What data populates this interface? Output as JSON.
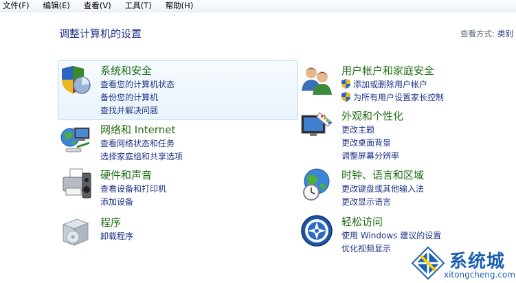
{
  "menubar": {
    "items": [
      "文件(F)",
      "编辑(E)",
      "查看(V)",
      "工具(T)",
      "帮助(H)"
    ]
  },
  "page_title": "调整计算机的设置",
  "view_mode": {
    "label": "查看方式:",
    "value": "类别"
  },
  "categories": {
    "system_security": {
      "title": "系统和安全",
      "links": [
        "查看您的计算机状态",
        "备份您的计算机",
        "查找并解决问题"
      ]
    },
    "network": {
      "title": "网络和 Internet",
      "links": [
        "查看网络状态和任务",
        "选择家庭组和共享选项"
      ]
    },
    "hardware": {
      "title": "硬件和声音",
      "links": [
        "查看设备和打印机",
        "添加设备"
      ]
    },
    "programs": {
      "title": "程序",
      "links": [
        "卸载程序"
      ]
    },
    "user_accounts": {
      "title": "用户帐户和家庭安全",
      "links": [
        "添加或删除用户帐户",
        "为所有用户设置家长控制"
      ]
    },
    "appearance": {
      "title": "外观和个性化",
      "links": [
        "更改主题",
        "更改桌面背景",
        "调整屏幕分辨率"
      ]
    },
    "clock": {
      "title": "时钟、语言和区域",
      "links": [
        "更改键盘或其他输入法",
        "更改显示语言"
      ]
    },
    "ease": {
      "title": "轻松访问",
      "links": [
        "使用 Windows 建议的设置",
        "优化视频显示"
      ]
    }
  },
  "watermark": {
    "title": "系统城",
    "subtitle": "xitongcheng.com"
  },
  "colors": {
    "title_green": "#1e6c12",
    "link_blue": "#1e3287",
    "highlight_border": "#b7d5ee"
  }
}
